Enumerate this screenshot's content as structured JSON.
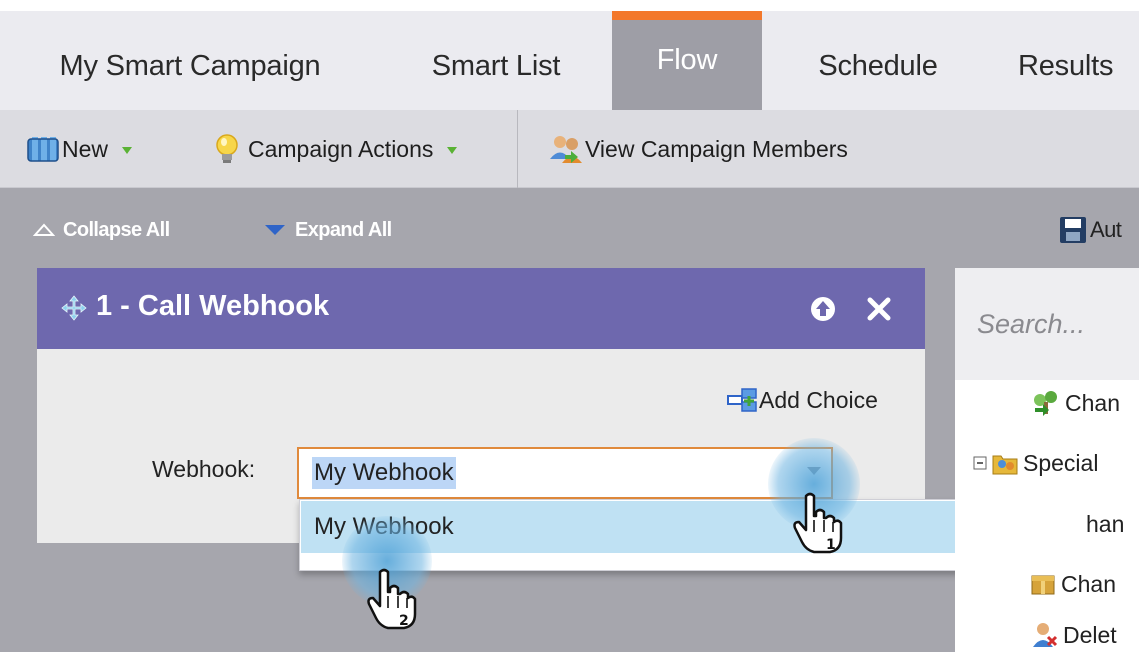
{
  "tabs": [
    {
      "label": "My Smart Campaign"
    },
    {
      "label": "Smart List"
    },
    {
      "label": "Flow"
    },
    {
      "label": "Schedule"
    },
    {
      "label": "Results"
    }
  ],
  "active_tab": "Flow",
  "toolbar": {
    "new_label": "New",
    "campaign_actions_label": "Campaign Actions",
    "view_members_label": "View Campaign Members"
  },
  "subbar": {
    "collapse_label": "Collapse All",
    "expand_label": "Expand All",
    "auto_label": "Aut"
  },
  "step": {
    "title": "1 - Call Webhook",
    "add_choice_label": "Add Choice",
    "webhook_label": "Webhook:",
    "webhook_value": "My Webhook",
    "dropdown_options": [
      {
        "label": "My Webhook"
      }
    ]
  },
  "side_panel": {
    "search_placeholder": "Search...",
    "items": [
      {
        "label": "Chan"
      },
      {
        "label": "Special"
      },
      {
        "label": "han"
      },
      {
        "label": "Chan"
      },
      {
        "label": "Delet"
      }
    ]
  },
  "cursors": [
    {
      "step": "1"
    },
    {
      "step": "2"
    }
  ],
  "colors": {
    "accent": "#f3782b",
    "step_header": "#6e68ae",
    "select_border": "#e08a3c",
    "option_highlight": "#bfe1f3"
  }
}
